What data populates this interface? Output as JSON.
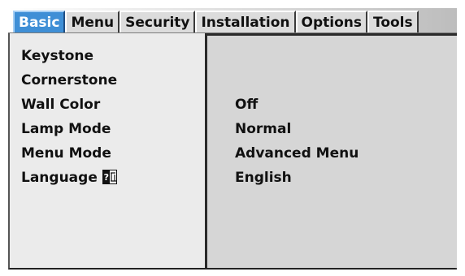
{
  "tabs": [
    {
      "label": "Basic",
      "active": true
    },
    {
      "label": "Menu",
      "active": false
    },
    {
      "label": "Security",
      "active": false
    },
    {
      "label": "Installation",
      "active": false
    },
    {
      "label": "Options",
      "active": false
    },
    {
      "label": "Tools",
      "active": false
    }
  ],
  "menu": {
    "items": [
      {
        "label": "Keystone"
      },
      {
        "label": "Cornerstone"
      },
      {
        "label": "Wall Color",
        "value": "Off"
      },
      {
        "label": "Lamp Mode",
        "value": "Normal"
      },
      {
        "label": "Menu Mode",
        "value": "Advanced Menu"
      },
      {
        "label": "Language",
        "value": "English",
        "icon": "language-icon"
      }
    ]
  },
  "colors": {
    "active_tab": "#3f8fd6",
    "left_panel": "#ebebeb",
    "right_panel": "#d6d6d6"
  }
}
